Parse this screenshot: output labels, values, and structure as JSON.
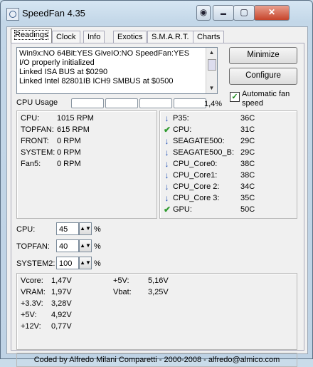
{
  "window": {
    "title": "SpeedFan 4.35",
    "minimize_glyph": "▬",
    "maximize_glyph": "▢",
    "close_glyph": "✕",
    "tray_glyph": "◉"
  },
  "tabs": [
    {
      "label": "Readings"
    },
    {
      "label": "Clock"
    },
    {
      "label": "Info"
    },
    {
      "label": "Exotics"
    },
    {
      "label": "S.M.A.R.T."
    },
    {
      "label": "Charts"
    }
  ],
  "log": [
    "Win9x:NO  64Bit:YES  GiveIO:NO  SpeedFan:YES",
    "I/O properly initialized",
    "Linked ISA BUS at $0290",
    "Linked Intel 82801IB ICH9 SMBUS at $0500"
  ],
  "buttons": {
    "minimize": "Minimize",
    "configure": "Configure"
  },
  "auto_fan": {
    "label": "Automatic fan speed",
    "checked": true,
    "check_glyph": "✓"
  },
  "cpu_usage": {
    "label": "CPU Usage",
    "percent": "1,4%",
    "segments": 5
  },
  "fans": [
    {
      "name": "CPU:",
      "value": "1015 RPM"
    },
    {
      "name": "TOPFAN:",
      "value": "615 RPM"
    },
    {
      "name": "FRONT:",
      "value": "0 RPM"
    },
    {
      "name": "SYSTEM:",
      "value": "0 RPM"
    },
    {
      "name": "Fan5:",
      "value": "0 RPM"
    }
  ],
  "temps": [
    {
      "name": "P35:",
      "value": "36C",
      "status": "down",
      "glyph": "↓"
    },
    {
      "name": "CPU:",
      "value": "31C",
      "status": "ok",
      "glyph": "✔"
    },
    {
      "name": "SEAGATE500:",
      "value": "29C",
      "status": "down",
      "glyph": "↓"
    },
    {
      "name": "SEAGATE500_B:",
      "value": "29C",
      "status": "down",
      "glyph": "↓"
    },
    {
      "name": "CPU_Core0:",
      "value": "38C",
      "status": "down",
      "glyph": "↓"
    },
    {
      "name": "CPU_Core1:",
      "value": "38C",
      "status": "down",
      "glyph": "↓"
    },
    {
      "name": "CPU_Core 2:",
      "value": "34C",
      "status": "down",
      "glyph": "↓"
    },
    {
      "name": "CPU_Core 3:",
      "value": "35C",
      "status": "down",
      "glyph": "↓"
    },
    {
      "name": "GPU:",
      "value": "50C",
      "status": "ok",
      "glyph": "✔"
    }
  ],
  "speeds": [
    {
      "name": "CPU:",
      "value": "45",
      "unit": "%"
    },
    {
      "name": "TOPFAN:",
      "value": "40",
      "unit": "%"
    },
    {
      "name": "SYSTEM2:",
      "value": "100",
      "unit": "%"
    }
  ],
  "spin_glyph": "▲▼",
  "voltages_left": [
    {
      "name": "Vcore:",
      "value": "1,47V"
    },
    {
      "name": "VRAM:",
      "value": "1,97V"
    },
    {
      "name": "+3.3V:",
      "value": "3,28V"
    },
    {
      "name": "+5V:",
      "value": "4,92V"
    },
    {
      "name": "+12V:",
      "value": "0,77V"
    }
  ],
  "voltages_right": [
    {
      "name": "+5V:",
      "value": "5,16V"
    },
    {
      "name": "Vbat:",
      "value": "3,25V"
    }
  ],
  "footer": "Coded by Alfredo Milani Comparetti - 2000-2008 - alfredo@almico.com"
}
